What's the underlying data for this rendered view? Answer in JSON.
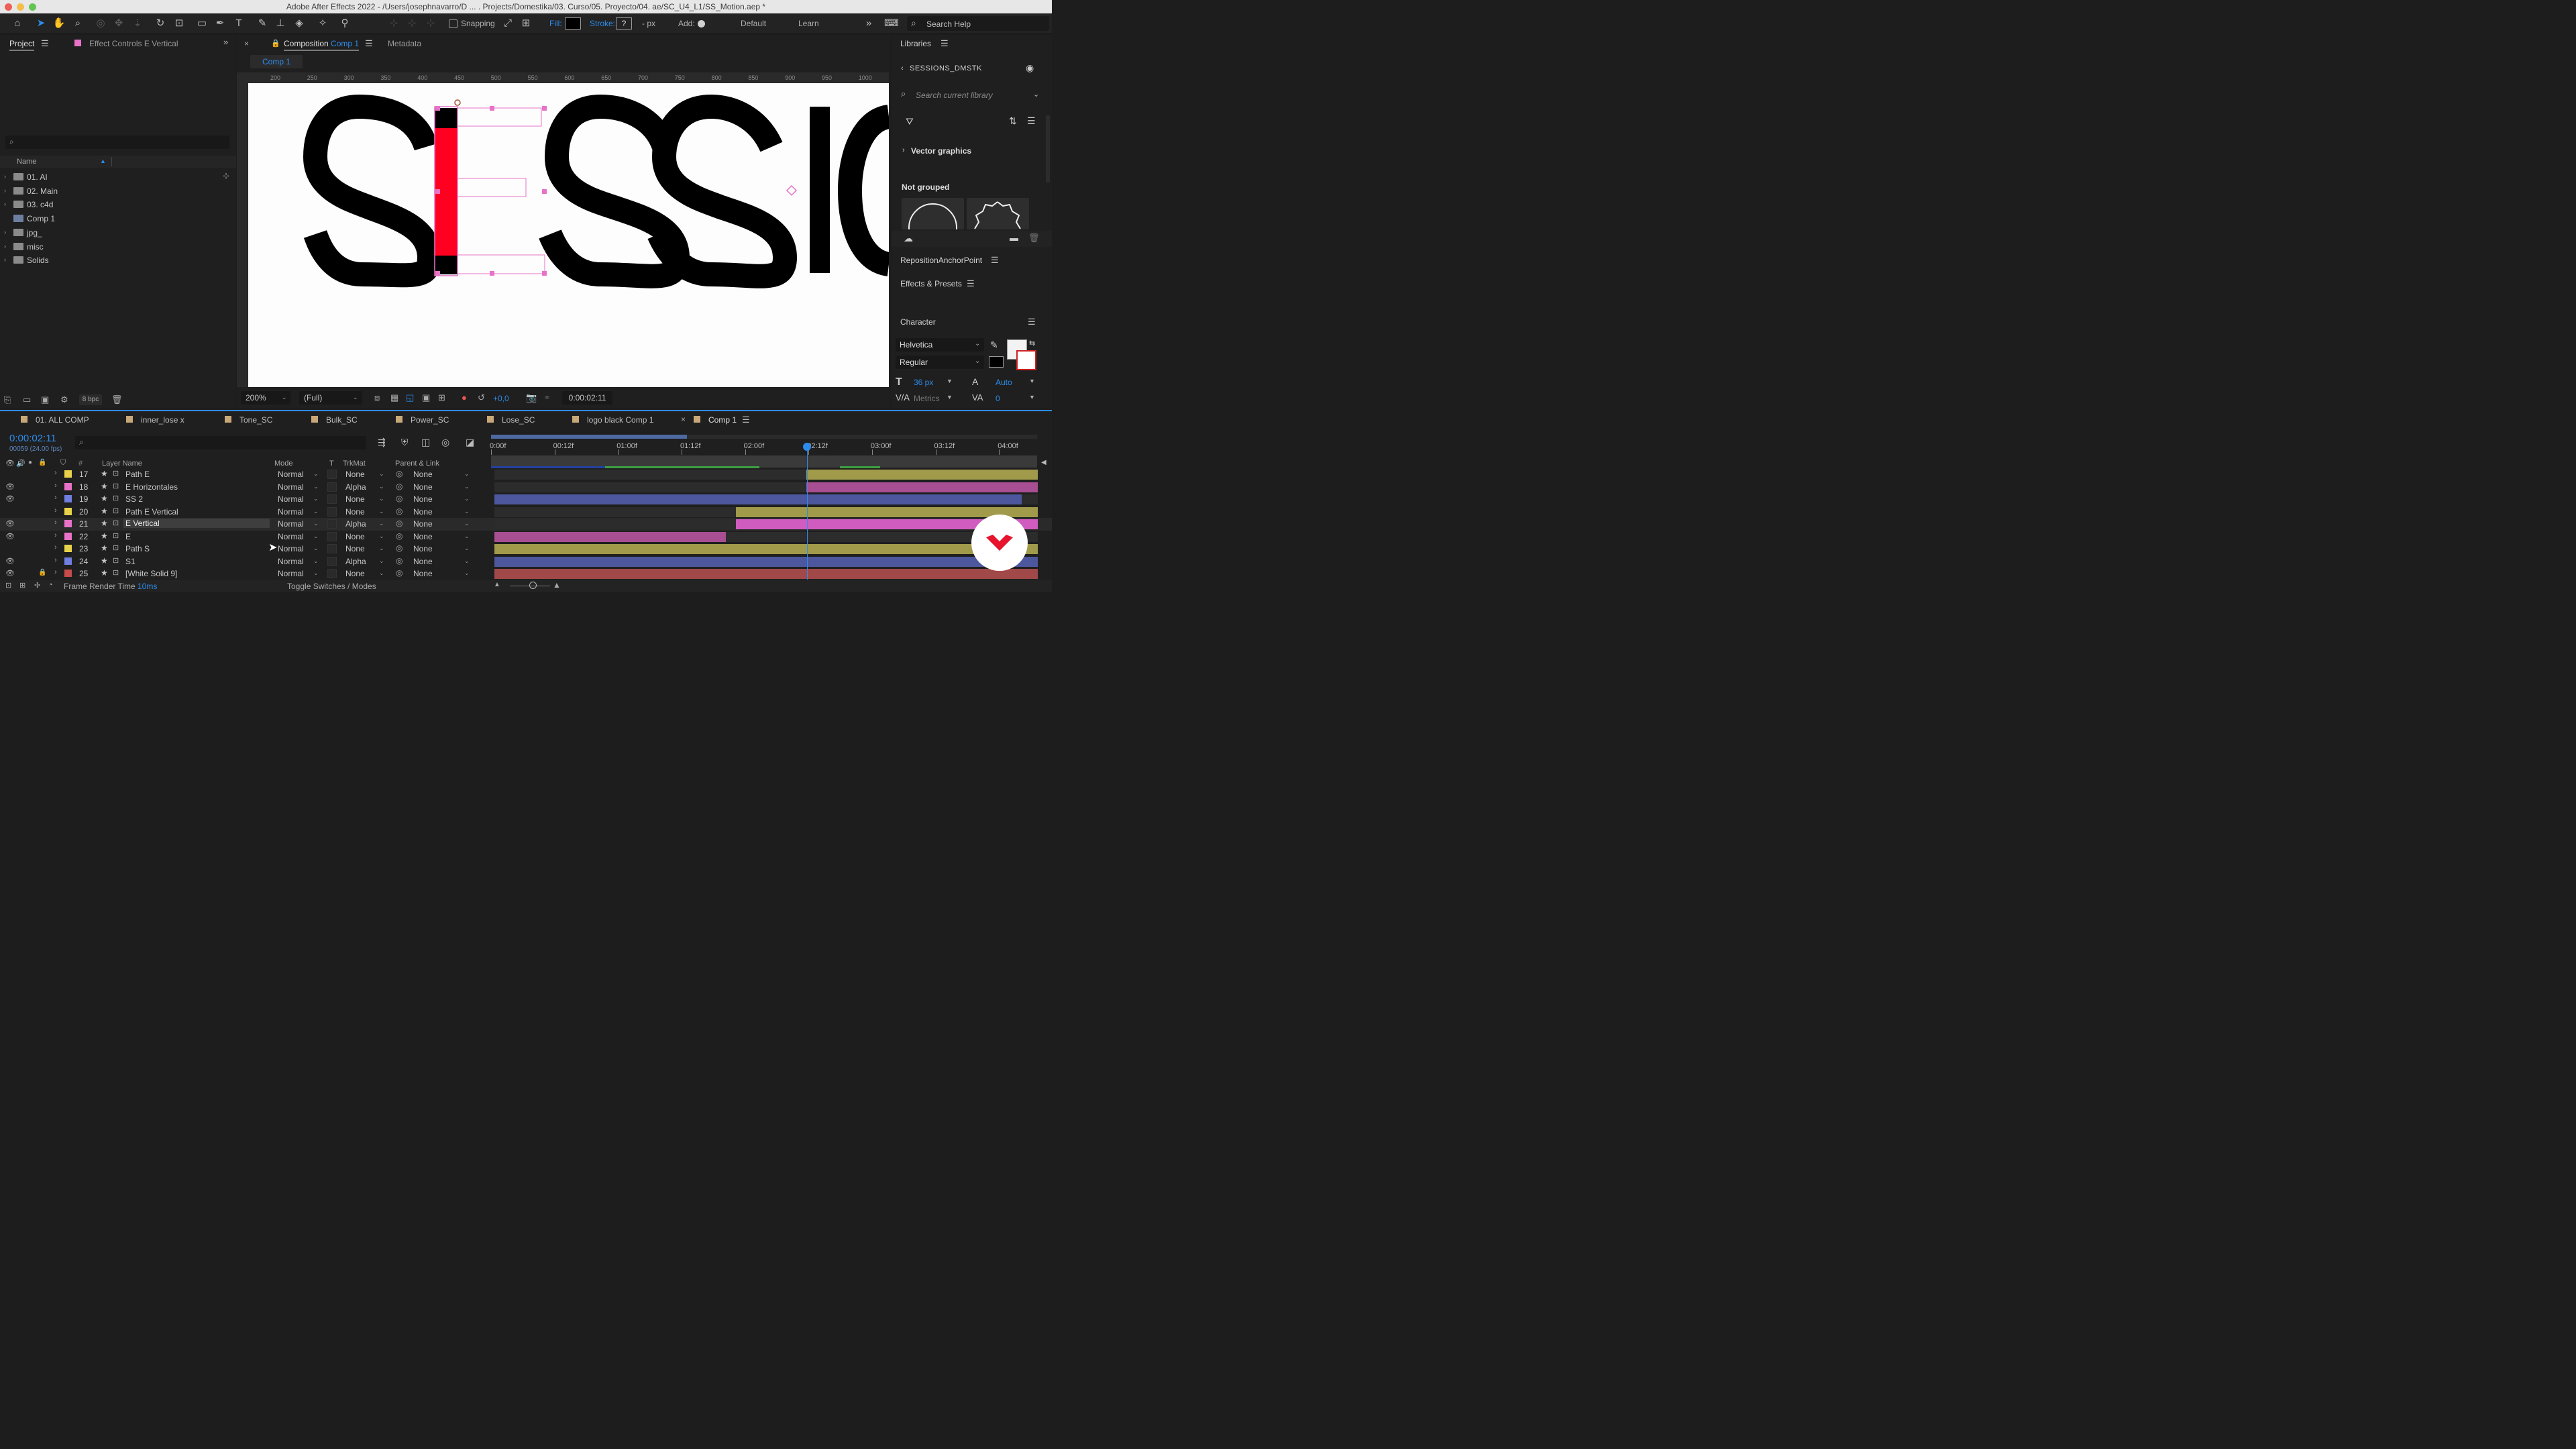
{
  "window": {
    "title": "Adobe After Effects 2022 - /Users/josephnavarro/D ... . Projects/Domestika/03. Curso/05. Proyecto/04. ae/SC_U4_L1/SS_Motion.aep *"
  },
  "toolbar": {
    "snapping_label": "Snapping",
    "fill_label": "Fill:",
    "stroke_label": "Stroke:",
    "stroke_value": "?",
    "stroke_unit": "- px",
    "add_label": "Add:",
    "workspace_default": "Default",
    "workspace_learn": "Learn",
    "search_help_placeholder": "Search Help"
  },
  "project_panel": {
    "tab_project": "Project",
    "tab_effect_controls": "Effect Controls E Vertical",
    "column_name": "Name",
    "items": [
      {
        "label": "01. AI",
        "type": "folder"
      },
      {
        "label": "02. Main",
        "type": "folder"
      },
      {
        "label": "03. c4d",
        "type": "folder"
      },
      {
        "label": "Comp 1",
        "type": "comp"
      },
      {
        "label": "jpg_",
        "type": "folder"
      },
      {
        "label": "misc",
        "type": "folder"
      },
      {
        "label": "Solids",
        "type": "folder"
      }
    ],
    "bpc": "8 bpc"
  },
  "composition_panel": {
    "tab_prefix": "Composition",
    "tab_comp": "Comp 1",
    "tab_metadata": "Metadata",
    "breadcrumb": "Comp 1",
    "ruler_labels": [
      "200",
      "250",
      "300",
      "350",
      "400",
      "450",
      "500",
      "550",
      "600",
      "650",
      "700",
      "750",
      "800",
      "850",
      "900",
      "950",
      "1000"
    ],
    "zoom": "200%",
    "resolution": "(Full)",
    "exposure": "+0,0",
    "timecode": "0:00:02:11"
  },
  "libraries": {
    "title": "Libraries",
    "library_name": "SESSIONS_DMSTK",
    "search_placeholder": "Search current library",
    "section": "Vector graphics",
    "group": "Not grouped"
  },
  "right_panels": {
    "reposition": "RepositionAnchorPoint",
    "effects_presets": "Effects & Presets",
    "character": "Character",
    "font": "Helvetica",
    "style": "Regular",
    "size": "36 px",
    "leading": "Auto",
    "kerning": "Metrics",
    "tracking": "0"
  },
  "timeline": {
    "tabs": [
      {
        "label": "01. ALL COMP",
        "color": "#c8a878"
      },
      {
        "label": "inner_lose x",
        "color": "#c8a878"
      },
      {
        "label": "Tone_SC",
        "color": "#c8a878"
      },
      {
        "label": "Bulk_SC",
        "color": "#c8a878"
      },
      {
        "label": "Power_SC",
        "color": "#c8a878"
      },
      {
        "label": "Lose_SC",
        "color": "#c8a878"
      },
      {
        "label": "logo black Comp 1",
        "color": "#c8a878"
      },
      {
        "label": "Comp 1",
        "color": "#c8a878"
      }
    ],
    "timecode": "0:00:02:11",
    "frame_info": "00059 (24.00 fps)",
    "ruler": [
      "0:00f",
      "00:12f",
      "01:00f",
      "01:12f",
      "02:00f",
      "02:12f",
      "03:00f",
      "03:12f",
      "04:00f"
    ],
    "columns": {
      "layer_name": "Layer Name",
      "mode": "Mode",
      "t": "T",
      "trkmat": "TrkMat",
      "parent": "Parent & Link"
    },
    "layers": [
      {
        "num": "17",
        "name": "Path E",
        "color": "#e8d24a",
        "mode": "Normal",
        "trkmat": "None",
        "parent": "None",
        "eye": false,
        "lock": false,
        "bar_color": "#a09a4a",
        "bar_start": 2.47,
        "bar_end": 4.3
      },
      {
        "num": "18",
        "name": "E Horizontales",
        "color": "#e872c8",
        "mode": "Normal",
        "trkmat": "Alpha",
        "parent": "None",
        "eye": true,
        "lock": false,
        "bar_color": "#a84e92",
        "bar_start": 2.47,
        "bar_end": 4.3
      },
      {
        "num": "19",
        "name": "SS 2",
        "color": "#6f7ee0",
        "mode": "Normal",
        "trkmat": "None",
        "parent": "None",
        "eye": true,
        "lock": false,
        "bar_color": "#4c579d",
        "bar_start": 0.0,
        "bar_end": 4.17
      },
      {
        "num": "20",
        "name": "Path E Vertical",
        "color": "#e8d24a",
        "mode": "Normal",
        "trkmat": "None",
        "parent": "None",
        "eye": false,
        "lock": false,
        "bar_color": "#a09a4a",
        "bar_start": 1.91,
        "bar_end": 4.3
      },
      {
        "num": "21",
        "name": "E Vertical",
        "color": "#e872c8",
        "mode": "Normal",
        "trkmat": "Alpha",
        "parent": "None",
        "eye": true,
        "lock": false,
        "bar_color": "#d05cc0",
        "bar_start": 1.91,
        "bar_end": 4.3,
        "selected": true
      },
      {
        "num": "22",
        "name": "E",
        "color": "#e872c8",
        "mode": "Normal",
        "trkmat": "None",
        "parent": "None",
        "eye": true,
        "lock": false,
        "bar_color": "#a84e92",
        "bar_start": 0.0,
        "bar_end": 1.83
      },
      {
        "num": "23",
        "name": "Path S",
        "color": "#e8d24a",
        "mode": "Normal",
        "trkmat": "None",
        "parent": "None",
        "eye": false,
        "lock": false,
        "bar_color": "#a09a4a",
        "bar_start": 0.0,
        "bar_end": 4.3
      },
      {
        "num": "24",
        "name": "S1",
        "color": "#6f7ee0",
        "mode": "Normal",
        "trkmat": "Alpha",
        "parent": "None",
        "eye": true,
        "lock": false,
        "bar_color": "#4c579d",
        "bar_start": 0.0,
        "bar_end": 4.3
      },
      {
        "num": "25",
        "name": "[White Solid 9]",
        "color": "#c84a4a",
        "mode": "Normal",
        "trkmat": "None",
        "parent": "None",
        "eye": true,
        "lock": true,
        "bar_color": "#a14848",
        "bar_start": 0.0,
        "bar_end": 4.3
      }
    ],
    "frame_render_label": "Frame Render Time",
    "frame_render_value": "10ms",
    "toggle_label": "Toggle Switches / Modes"
  },
  "accent_colors": {
    "selection_blue": "#2d8ceb",
    "layer_highlight": "#3a3a3a",
    "red_bar": "#ff0021",
    "brand_red": "#e6142d"
  }
}
